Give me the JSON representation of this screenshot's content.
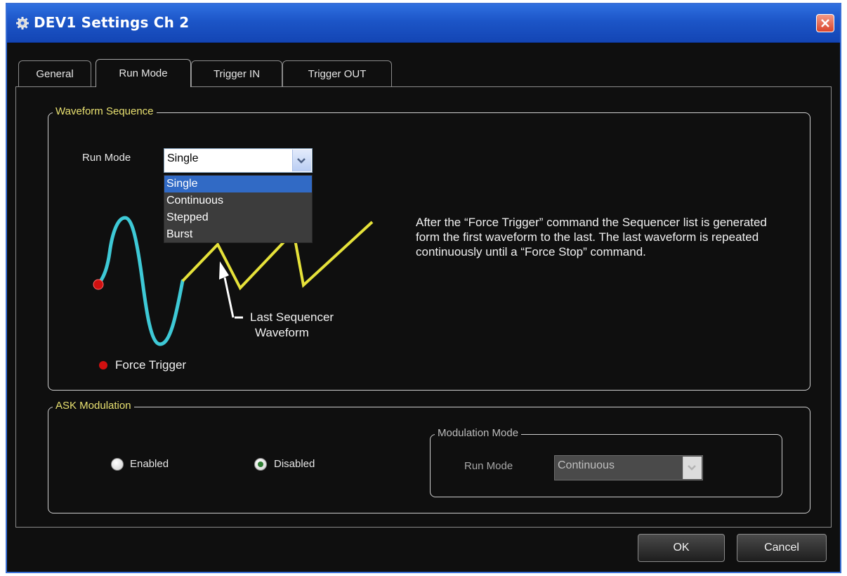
{
  "window": {
    "title": "DEV1 Settings Ch 2"
  },
  "tabs": [
    {
      "label": "General"
    },
    {
      "label": "Run Mode",
      "active": true
    },
    {
      "label": "Trigger IN"
    },
    {
      "label": "Trigger OUT"
    }
  ],
  "waveform_sequence": {
    "legend": "Waveform Sequence",
    "run_mode_label": "Run Mode",
    "run_mode_value": "Single",
    "options": [
      "Single",
      "Continuous",
      "Stepped",
      "Burst"
    ],
    "selected_option": "Single",
    "diagram": {
      "callout": "Last Sequencer Waveform",
      "callout_line1": "Last Sequencer",
      "callout_line2": "Waveform",
      "marker_label": "Force Trigger"
    },
    "description": "After the “Force Trigger” command the Sequencer list is generated form the first waveform to the last. The last waveform is repeated continuously until a “Force Stop” command."
  },
  "ask_modulation": {
    "legend": "ASK Modulation",
    "enabled_label": "Enabled",
    "disabled_label": "Disabled",
    "selected": "Disabled",
    "modulation_mode": {
      "legend": "Modulation Mode",
      "run_mode_label": "Run Mode",
      "run_mode_value": "Continuous"
    }
  },
  "buttons": {
    "ok": "OK",
    "cancel": "Cancel"
  },
  "colors": {
    "accent_title": "#e8e070",
    "sine_wave": "#3ec9d6",
    "sawtooth_wave": "#e6e23a",
    "marker": "#d01010",
    "selection": "#316ac5"
  }
}
